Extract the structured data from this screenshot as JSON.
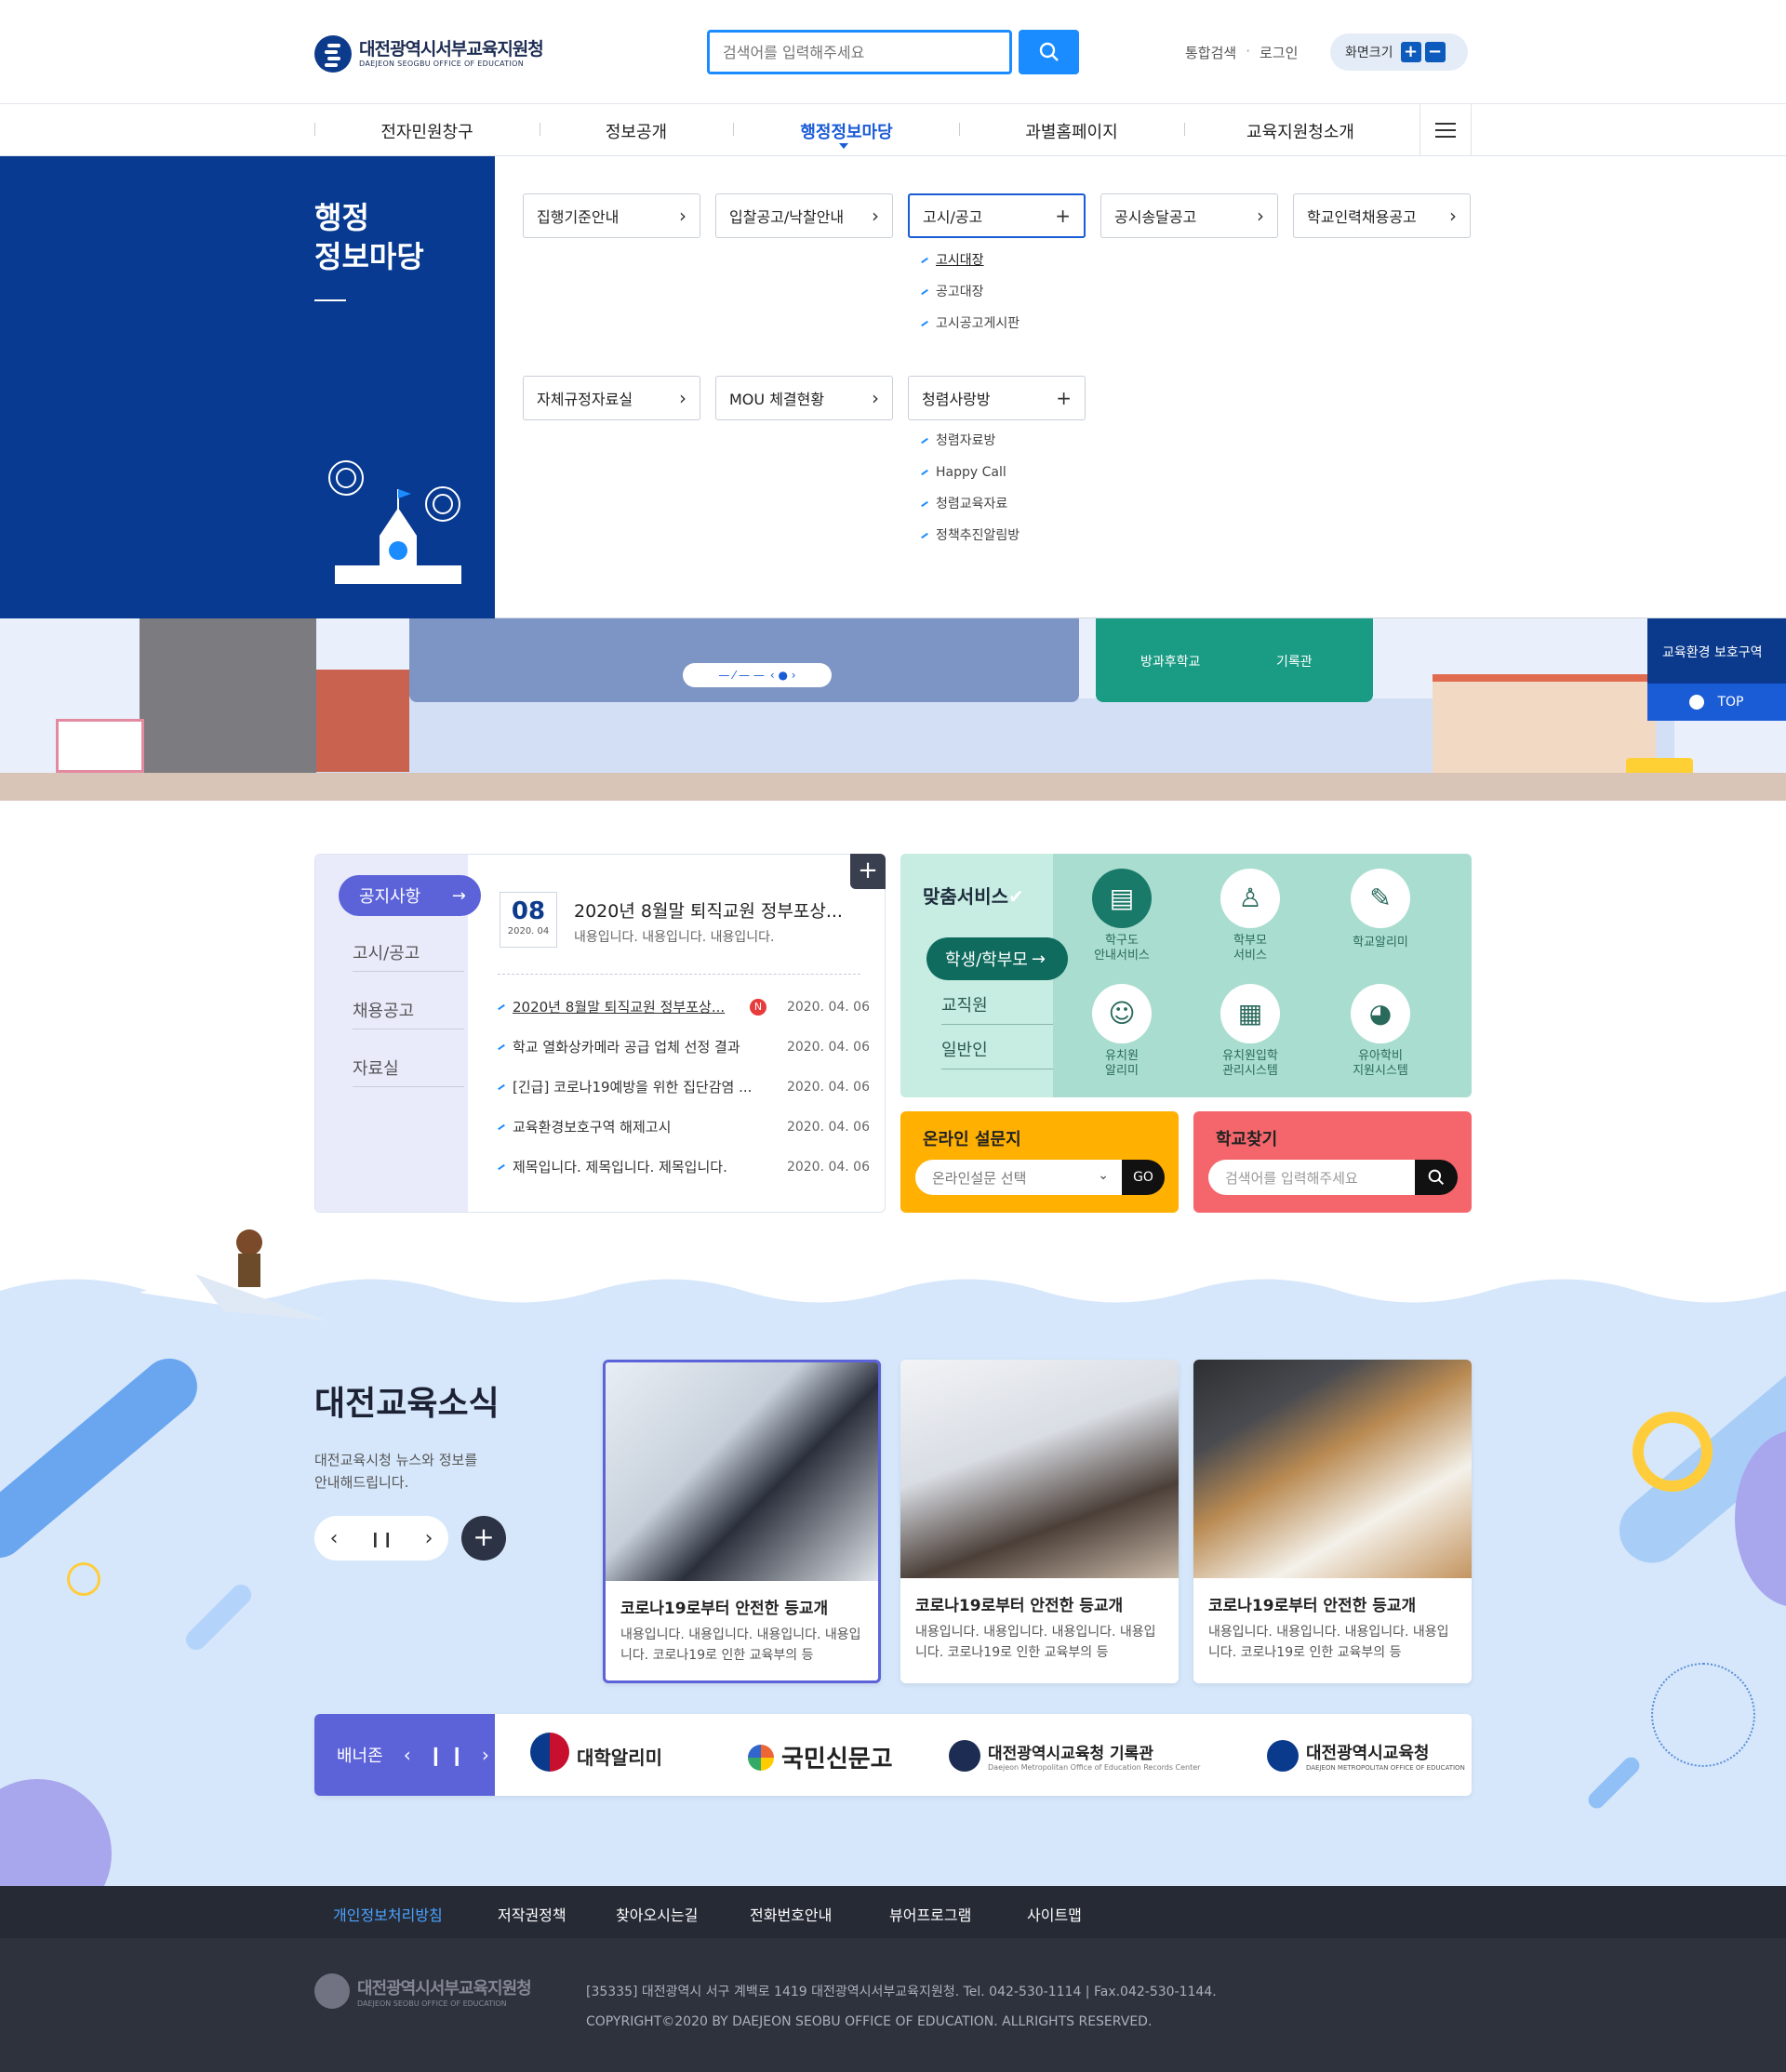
{
  "header": {
    "logo_main": "대전광역시서부교육지원청",
    "logo_sub": "DAEJEON SEOGBU OFFICE OF EDUCATION",
    "search_placeholder": "검색어를 입력해주세요",
    "util": [
      "통합검색",
      "로그인"
    ],
    "zoom_label": "화면크기"
  },
  "gnb": {
    "items": [
      "전자민원창구",
      "정보공개",
      "행정정보마당",
      "과별홈페이지",
      "교육지원청소개"
    ],
    "active": "행정정보마당"
  },
  "mega": {
    "title_line1": "행정",
    "title_line2": "정보마당",
    "row1": [
      {
        "label": "집행기준안내",
        "icon": "chevron-right-icon"
      },
      {
        "label": "입찰공고/낙찰안내",
        "icon": "chevron-right-icon"
      },
      {
        "label": "고시/공고",
        "icon": "plus-icon",
        "sub": [
          "고시대장",
          "공고대장",
          "고시공고게시판"
        ]
      },
      {
        "label": "공시송달공고",
        "icon": "chevron-right-icon"
      },
      {
        "label": "학교인력채용공고",
        "icon": "chevron-right-icon"
      }
    ],
    "row2": [
      {
        "label": "자체규정자료실",
        "icon": "chevron-right-icon"
      },
      {
        "label": "MOU 체결현황",
        "icon": "chevron-right-icon"
      },
      {
        "label": "청렴사랑방",
        "icon": "plus-icon",
        "sub": [
          "청렴자료방",
          "Happy Call",
          "청렴교육자료",
          "정책추진알림방"
        ]
      }
    ]
  },
  "visual": {
    "quick": [
      "방과후학교",
      "기록관"
    ],
    "side_pop": "교육환경 보호구역",
    "top_label": "TOP"
  },
  "notice": {
    "tabs": [
      "공지사항",
      "고시/공고",
      "채용공고",
      "자료실"
    ],
    "date_day": "08",
    "date_month": "2020. 04",
    "headline": "2020년 8월말 퇴직교원 정부포상...",
    "headline_desc": "내용입니다. 내용입니다. 내용입니다.",
    "rows": [
      {
        "title": "2020년 8월말 퇴직교원 정부포상...",
        "new": "N",
        "date": "2020. 04. 06"
      },
      {
        "title": "학교 열화상카메라 공급 업체 선정 결과",
        "date": "2020. 04. 06"
      },
      {
        "title": "[긴급] 코로나19예방을 위한 집단감염 ...",
        "date": "2020. 04. 06"
      },
      {
        "title": "교육환경보호구역 해제고시",
        "date": "2020. 04. 06"
      },
      {
        "title": "제목입니다. 제목입니다. 제목입니다.",
        "date": "2020. 04. 06"
      }
    ]
  },
  "service": {
    "title": "맞춤서비스",
    "tabs": [
      "학생/학부모",
      "교직원",
      "일반인"
    ],
    "items": [
      {
        "label1": "학구도",
        "label2": "안내서비스",
        "icon": "book-icon"
      },
      {
        "label1": "학부모",
        "label2": "서비스",
        "icon": "parent-icon"
      },
      {
        "label1": "학교알리미",
        "label2": "",
        "icon": "chat-icon"
      },
      {
        "label1": "유치원",
        "label2": "알리미",
        "icon": "child-icon"
      },
      {
        "label1": "유치원입학",
        "label2": "관리시스템",
        "icon": "document-icon"
      },
      {
        "label1": "유아학비",
        "label2": "지원시스템",
        "icon": "piggy-bank-icon"
      }
    ]
  },
  "survey": {
    "title": "온라인 설문지",
    "select": "온라인설문 선택",
    "go": "GO"
  },
  "school_find": {
    "title": "학교찾기",
    "placeholder": "검색어를 입력해주세요"
  },
  "news": {
    "title": "대전교육소식",
    "desc_line1": "대전교육시청 뉴스와 정보를",
    "desc_line2": "안내해드립니다.",
    "cards": [
      {
        "title": "코로나19로부터 안전한 등교개",
        "desc": "내용입니다. 내용입니다. 내용입니다. 내용입니다. 코로나19로 인한 교육부의 등"
      },
      {
        "title": "코로나19로부터 안전한 등교개",
        "desc": "내용입니다. 내용입니다. 내용입니다. 내용입니다. 코로나19로 인한 교육부의 등"
      },
      {
        "title": "코로나19로부터 안전한 등교개",
        "desc": "내용입니다. 내용입니다. 내용입니다. 내용입니다. 코로나19로 인한 교육부의 등"
      }
    ]
  },
  "banner_zone": {
    "label": "배너존",
    "items": [
      "대학알리미",
      "국민신문고",
      "대전광역시교육청 기록관",
      "대전광역시교육청"
    ],
    "sub3": "Daejeon Metropolitan Office of Education Records Center",
    "sub4": "DAEJEON METROPOLITAN OFFICE OF EDUCATION"
  },
  "footer": {
    "links": [
      "개인정보처리방침",
      "저작권정책",
      "찾아오시는길",
      "전화번호안내",
      "뷰어프로그램",
      "사이트맵"
    ],
    "address": "[35335] 대전광역시 서구 계백로 1419 대전광역시서부교육지원청. Tel. 042-530-1114 | Fax.042-530-1144.",
    "copyright": "COPYRIGHT©2020 BY DAEJEON SEOBU OFFICE OF EDUCATION. ALLRIGHTS RESERVED.",
    "logo_main": "대전광역시서부교육지원청",
    "logo_sub": "DAEJEON SEOBU OFFICE OF EDUCATION"
  },
  "colors": {
    "primary": "#073a90",
    "accent": "#1a8cff",
    "purple": "#5c63d9",
    "mint": "#a9ddd0",
    "yellow": "#ffb000",
    "coral": "#f4666b"
  }
}
